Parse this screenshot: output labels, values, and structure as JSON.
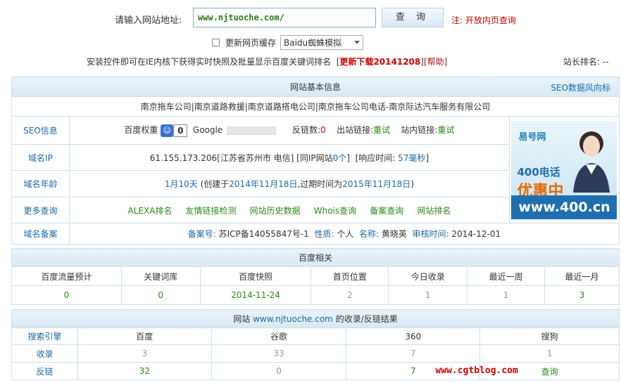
{
  "search": {
    "label": "请输入网站地址:",
    "value": "www.njtuoche.com/",
    "button": "查 询",
    "note": "注: 开放内页查询",
    "cache_label": "更新网页缓存",
    "engine_selected": "Baidu蜘蛛模拟"
  },
  "install": {
    "text": "安装控件即可在IE内核下获得实时快照及批量显示百度关键词排名",
    "download_open": "[",
    "download": "更新下载20141208",
    "download_close": "]",
    "help": "[帮助]"
  },
  "admin_rank": "站长排名: --",
  "basic": {
    "header": "网站基本信息",
    "seo_link": "SEO数据风向标",
    "site_title": "南京拖车公司|南京道路救援|南京道路搭电公司|南京拖车公司电话-南京际达汽车服务有限公司",
    "rows": {
      "seo_label": "SEO信息",
      "baidu_weight_label": "百度权重",
      "baidu_weight": "0",
      "google_label": "Google",
      "backlinks_label": "反链数:",
      "backlinks_value": "0",
      "outlinks_label": "出站链接:",
      "outlinks_value": "重试",
      "inlinks_label": "站内链接:",
      "inlinks_value": "重试",
      "ip_label": "域名IP",
      "ip_text": "61.155.173.206[江苏省苏州市 电信] [同IP网站",
      "ip_count": "0个",
      "ip_close": "]",
      "resp_label": "[响应时间:",
      "resp_value": "57毫秒",
      "resp_close": "]",
      "age_label": "域名年龄",
      "age_value": "1月10天",
      "age_created_label": "(创建于",
      "age_created": "2014年11月18日",
      "age_expire_label": ",过期时间为",
      "age_expire": "2015年11月18日",
      "age_close": ")",
      "more_label": "更多查询",
      "more_links": [
        "ALEXA排名",
        "友情链接检测",
        "网站历史数据",
        "Whois查询",
        "备案查询",
        "网站排名"
      ],
      "icp_label": "域名备案",
      "icp_no_label": "备案号:",
      "icp_no": "苏ICP备14055847号-1",
      "nature_label": "性质:",
      "nature": "个人",
      "name_label": "名称:",
      "name": "黄晓英",
      "audit_label": "审核时间:",
      "audit": "2014-12-01"
    }
  },
  "ad": {
    "brand": "易号网",
    "line1": "400电话",
    "line2": "优惠中",
    "url": "www.400.cn"
  },
  "baidu": {
    "header": "百度相关",
    "columns": [
      "百度流量预计",
      "关键词库",
      "百度快照",
      "首页位置",
      "今日收录",
      "最近一周",
      "最近一月"
    ],
    "values": [
      "0",
      "0",
      "2014-11-24",
      "2",
      "1",
      "1",
      "3"
    ]
  },
  "index": {
    "header_prefix": "网站",
    "header_site": "www.njtuoche.com",
    "header_suffix": "的收录/反链结果",
    "columns": [
      "搜索引擎",
      "百度",
      "谷歌",
      "360",
      "搜狗"
    ],
    "rows": [
      {
        "label": "收录",
        "values": [
          "3",
          "33",
          "7",
          "1"
        ]
      },
      {
        "label": "反链",
        "values": [
          "32",
          "0",
          "7",
          "查询"
        ]
      }
    ],
    "watermark": "www.cgtblog.com"
  },
  "colors": {
    "accent": "#1a6aa8",
    "green": "#2a8a17",
    "red": "#c00000",
    "header_bg": "#dbe9f4"
  }
}
